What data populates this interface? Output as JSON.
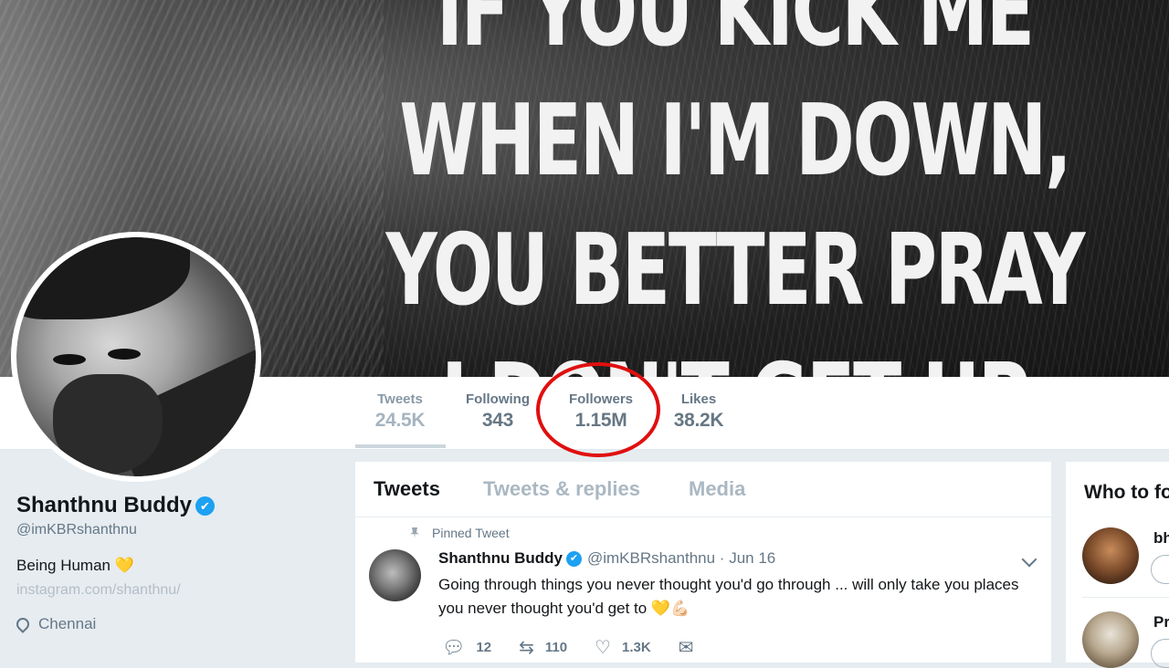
{
  "banner": {
    "quote_lines": [
      "IF YOU KICK ME",
      "WHEN I'M DOWN,",
      "YOU BETTER PRAY",
      "I DON'T GET UP"
    ]
  },
  "stats": [
    {
      "label": "Tweets",
      "value": "24.5K"
    },
    {
      "label": "Following",
      "value": "343"
    },
    {
      "label": "Followers",
      "value": "1.15M"
    },
    {
      "label": "Likes",
      "value": "38.2K"
    }
  ],
  "profile": {
    "name": "Shanthnu Buddy",
    "verified_icon": "✔",
    "handle": "@imKBRshanthnu",
    "bio": "Being Human",
    "bio_emoji": "💛",
    "website": "instagram.com/shanthnu/",
    "location": "Chennai"
  },
  "timeline": {
    "tabs": [
      "Tweets",
      "Tweets & replies",
      "Media"
    ],
    "pinned_label": "Pinned Tweet",
    "tweet": {
      "name": "Shanthnu Buddy",
      "handle_date": "@imKBRshanthnu · Jun 16",
      "text": "Going through things you never thought you'd go through ... will only take you places you never thought you'd get to 💛💪🏻",
      "replies": "12",
      "retweets": "110",
      "likes": "1.3K"
    }
  },
  "who_to_follow": {
    "title": "Who to follow",
    "suggestions": [
      {
        "name_fragment": "bh"
      },
      {
        "name_fragment": "Pr"
      }
    ]
  },
  "colors": {
    "accent": "#1da1f2",
    "highlight_circle": "#e00f0f",
    "background": "#e6ecf0"
  }
}
